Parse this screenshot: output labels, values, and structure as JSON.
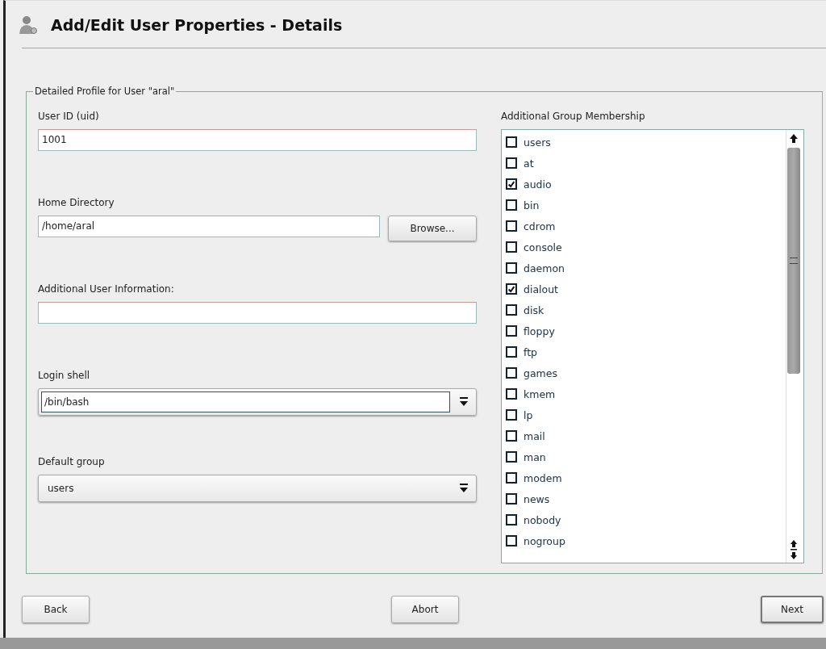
{
  "window": {
    "title": "Add/Edit User Properties - Details"
  },
  "group": {
    "title": "Detailed Profile for User \"aral\""
  },
  "fields": [
    {
      "kind": "text",
      "label": "User ID (uid)",
      "value": "1001"
    },
    {
      "kind": "browse",
      "label": "Home Directory",
      "value": "/home/aral",
      "button": "Browse..."
    },
    {
      "kind": "text",
      "label": "Additional User Information:"
    },
    {
      "kind": "combo-edit",
      "label": "Login shell",
      "value": "/bin/bash"
    },
    {
      "kind": "combo",
      "label": "Default group",
      "value": "users"
    }
  ],
  "groups": {
    "label": "Additional Group Membership",
    "items": [
      {
        "name": "users",
        "checked": false
      },
      {
        "name": "at",
        "checked": false
      },
      {
        "name": "audio",
        "checked": true
      },
      {
        "name": "bin",
        "checked": false
      },
      {
        "name": "cdrom",
        "checked": false
      },
      {
        "name": "console",
        "checked": false
      },
      {
        "name": "daemon",
        "checked": false
      },
      {
        "name": "dialout",
        "checked": true
      },
      {
        "name": "disk",
        "checked": false
      },
      {
        "name": "floppy",
        "checked": false
      },
      {
        "name": "ftp",
        "checked": false
      },
      {
        "name": "games",
        "checked": false
      },
      {
        "name": "kmem",
        "checked": false
      },
      {
        "name": "lp",
        "checked": false
      },
      {
        "name": "mail",
        "checked": false
      },
      {
        "name": "man",
        "checked": false
      },
      {
        "name": "modem",
        "checked": false
      },
      {
        "name": "news",
        "checked": false
      },
      {
        "name": "nobody",
        "checked": false
      },
      {
        "name": "nogroup",
        "checked": false
      }
    ]
  },
  "buttons": [
    {
      "label": "Back",
      "kind": "normal"
    },
    {
      "label": "Abort",
      "kind": "normal"
    },
    {
      "label": "Next",
      "kind": "default"
    }
  ]
}
